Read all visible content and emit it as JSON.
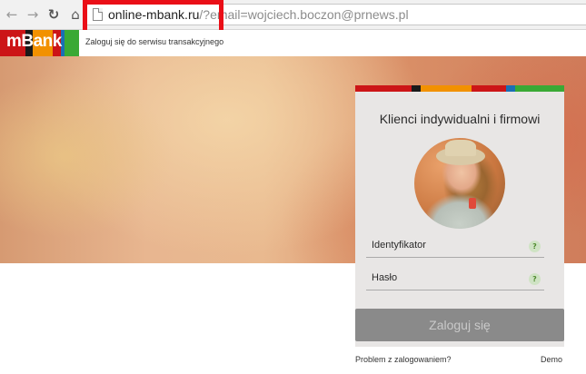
{
  "browser": {
    "back_icon": "arrow-left-icon",
    "forward_icon": "arrow-right-icon",
    "reload_icon": "reload-icon",
    "home_icon": "home-icon",
    "url_host": "online-mbank.ru",
    "url_path": "/?email=wojciech.boczon@prnews.pl"
  },
  "header": {
    "logo_text": "mBank",
    "tagline": "Zaloguj się do serwisu transakcyjnego"
  },
  "colors": {
    "brand_red": "#cc1517",
    "brand_black": "#1a1a1a",
    "brand_orange": "#f29100",
    "brand_blue": "#1a6fb5",
    "brand_green": "#3aa935",
    "highlight": "#ea0f17"
  },
  "login": {
    "title": "Klienci indywidualni i firmowi",
    "identifier_label": "Identyfikator",
    "password_label": "Hasło",
    "help_glyph": "?",
    "submit_label": "Zaloguj się",
    "problem_link": "Problem z zalogowaniem?",
    "demo_link": "Demo"
  }
}
